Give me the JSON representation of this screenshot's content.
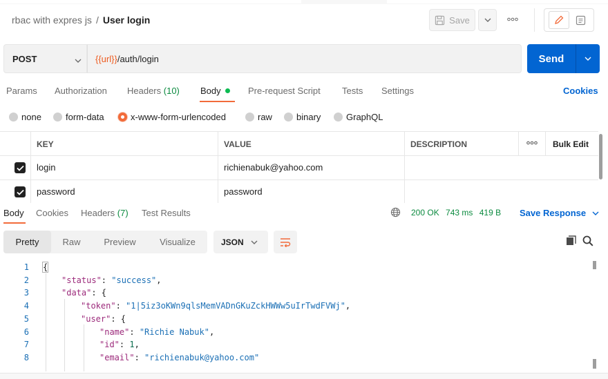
{
  "header": {
    "collection": "rbac with expres js",
    "separator": "/",
    "request_name": "User login",
    "save_label": "Save",
    "more_icon": "more-horizontal-icon",
    "mode_icons": [
      "pencil-icon",
      "document-icon"
    ]
  },
  "request": {
    "method": "POST",
    "url_variable": "{{url}}",
    "url_path": "/auth/login",
    "send_label": "Send"
  },
  "request_tabs": {
    "params": "Params",
    "authorization": "Authorization",
    "headers": "Headers",
    "headers_count": "(10)",
    "body": "Body",
    "prerequest": "Pre-request Script",
    "tests": "Tests",
    "settings": "Settings",
    "cookies": "Cookies"
  },
  "body_types": {
    "none": "none",
    "form_data": "form-data",
    "urlencoded": "x-www-form-urlencoded",
    "raw": "raw",
    "binary": "binary",
    "graphql": "GraphQL",
    "selected": "x-www-form-urlencoded"
  },
  "params_table": {
    "columns": {
      "key": "KEY",
      "value": "VALUE",
      "description": "DESCRIPTION",
      "bulk_edit": "Bulk Edit"
    },
    "rows": [
      {
        "checked": true,
        "key": "login",
        "value": "richienabuk@yahoo.com",
        "description": ""
      },
      {
        "checked": true,
        "key": "password",
        "value": "password",
        "description": ""
      }
    ]
  },
  "response_tabs": {
    "body": "Body",
    "cookies": "Cookies",
    "headers": "Headers",
    "headers_count": "(7)",
    "test_results": "Test Results",
    "status": "200 OK",
    "time": "743 ms",
    "size": "419 B",
    "save_response": "Save Response"
  },
  "view_modes": {
    "pretty": "Pretty",
    "raw": "Raw",
    "preview": "Preview",
    "visualize": "Visualize",
    "format": "JSON"
  },
  "code": {
    "line_numbers": [
      "1",
      "2",
      "3",
      "4",
      "5",
      "6",
      "7",
      "8"
    ],
    "open_brace": "{",
    "status_key": "\"status\"",
    "status_val": "\"success\"",
    "data_key": "\"data\"",
    "token_key": "\"token\"",
    "token_val": "\"1|5iz3oKWn9qlsMemVADnGKuZckHWWw5uIrTwdFVWj\"",
    "user_key": "\"user\"",
    "name_key": "\"name\"",
    "name_val": "\"Richie Nabuk\"",
    "id_key": "\"id\"",
    "id_val": "1",
    "email_key": "\"email\"",
    "email_val": "\"richienabuk@yahoo.com\""
  },
  "colors": {
    "accent_orange": "#f26b3a",
    "send_blue": "#0265d2",
    "status_green": "#0b8a3f",
    "url_variable": "#ee5a1e"
  }
}
